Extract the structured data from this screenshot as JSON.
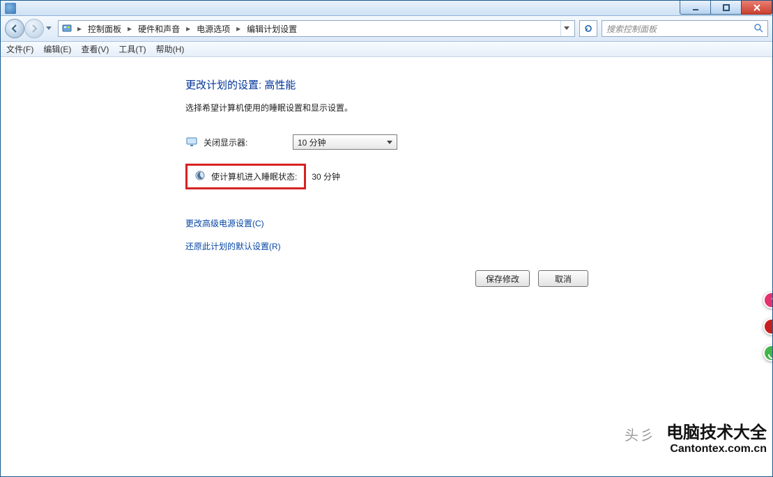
{
  "titlebar": {
    "min_tip": "最小化",
    "max_tip": "最大化",
    "close_tip": "关闭"
  },
  "breadcrumb": {
    "item0": "控制面板",
    "item1": "硬件和声音",
    "item2": "电源选项",
    "item3": "编辑计划设置"
  },
  "search": {
    "placeholder": "搜索控制面板"
  },
  "menu": {
    "file": "文件(F)",
    "edit": "编辑(E)",
    "view": "查看(V)",
    "tools": "工具(T)",
    "help": "帮助(H)"
  },
  "page": {
    "heading": "更改计划的设置: 高性能",
    "subtext": "选择希望计算机使用的睡眠设置和显示设置。",
    "display_off_label": "关闭显示器:",
    "display_off_value": "10 分钟",
    "sleep_label": "使计算机进入睡眠状态:",
    "sleep_value": "30 分钟",
    "link_adv": "更改高级电源设置(C)",
    "link_restore": "还原此计划的默认设置(R)",
    "btn_save": "保存修改",
    "btn_cancel": "取消"
  },
  "watermark": {
    "small": "头彡",
    "big_title": "电脑技术大全",
    "big_url": "Cantontex.com.cn"
  }
}
